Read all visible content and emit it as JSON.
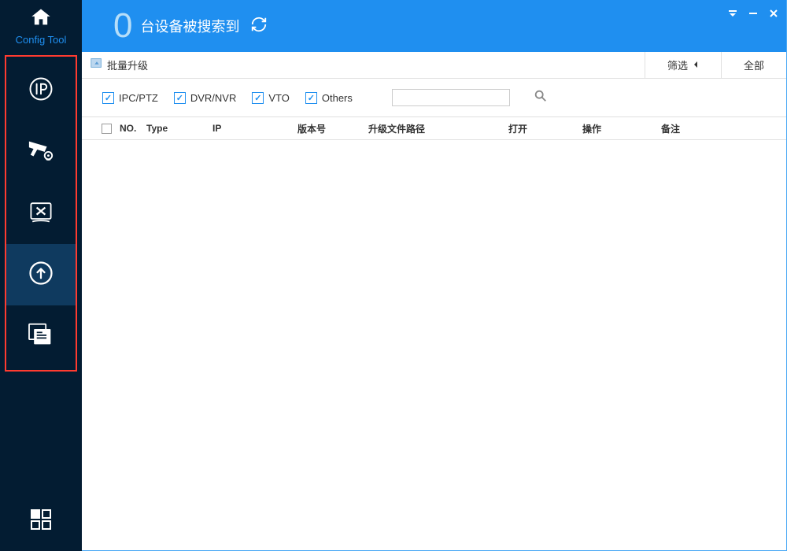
{
  "app_label": "Config Tool",
  "topbar": {
    "count": "0",
    "title": "台设备被搜索到"
  },
  "toolbar": {
    "batch_upgrade": "批量升级",
    "filter_btn": "筛选",
    "all_btn": "全部"
  },
  "filters": {
    "ipc_ptz": "IPC/PTZ",
    "dvr_nvr": "DVR/NVR",
    "vto": "VTO",
    "others": "Others"
  },
  "table": {
    "headers": {
      "no": "NO.",
      "type": "Type",
      "ip": "IP",
      "version": "版本号",
      "path": "升级文件路径",
      "open": "打开",
      "operate": "操作",
      "remark": "备注"
    }
  }
}
